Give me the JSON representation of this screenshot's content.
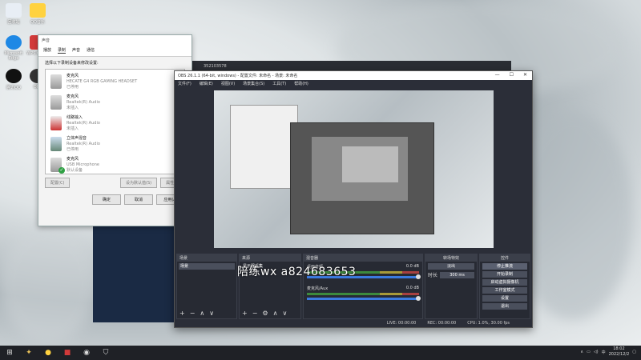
{
  "desktop": {
    "icons": [
      {
        "label": "回收站"
      },
      {
        "label": "QQ音乐"
      },
      {
        "label": "Microsoft Edge"
      },
      {
        "label": "WPS Office"
      },
      {
        "label": "腾讯QQ"
      },
      {
        "label": "OBS"
      }
    ]
  },
  "sound_dialog": {
    "title": "声音",
    "tabs": [
      "播放",
      "录制",
      "声音",
      "通信"
    ],
    "instruction": "选择以下录制设备来修改设置:",
    "devices": [
      {
        "name": "麦克风",
        "driver": "HECATE G4 RGB GAMING HEADSET",
        "status": "已停用"
      },
      {
        "name": "麦克风",
        "driver": "Realtek(R) Audio",
        "status": "未插入"
      },
      {
        "name": "线路输入",
        "driver": "Realtek(R) Audio",
        "status": "未插入"
      },
      {
        "name": "立体声混音",
        "driver": "Realtek(R) Audio",
        "status": "已停用"
      },
      {
        "name": "麦克风",
        "driver": "USB Microphone",
        "status": "默认设备"
      }
    ],
    "configure_label": "配置(C)",
    "set_default_label": "设为默认值(S)",
    "properties_label": "属性(P)",
    "ok_label": "确定",
    "cancel_label": "取消",
    "apply_label": "应用(A)"
  },
  "bg_bar": {
    "text": "352103578"
  },
  "obs": {
    "title": "OBS 26.1.1 (64-bit, windows) - 配置文件: 未命名 - 场景: 未命名",
    "menu": [
      "文件(F)",
      "编辑(E)",
      "视图(V)",
      "场景集合(S)",
      "工具(T)",
      "帮助(H)"
    ],
    "scenes_header": "场景",
    "scenes": [
      "场景"
    ],
    "sources_header": "来源",
    "sources": [
      "显示器采集"
    ],
    "mixer_header": "混音器",
    "mixer_tracks": [
      {
        "name": "桌面音频",
        "db": "0.0 dB"
      },
      {
        "name": "麦克风/Aux",
        "db": "0.0 dB"
      }
    ],
    "transitions_header": "转场特效",
    "transition_type": "淡出",
    "duration_label": "时长",
    "duration_value": "300 ms",
    "controls_header": "控件",
    "controls": [
      "停止推流",
      "开始录制",
      "启动虚拟摄像机",
      "工作室模式",
      "设置",
      "退出"
    ],
    "status": {
      "live": "LIVE: 00:00:00",
      "rec": "REC: 00:00:00",
      "cpu": "CPU: 1.0%, 30.00 fps"
    }
  },
  "watermark": "陪练wx a824683653",
  "taskbar": {
    "time": "18:02",
    "date": "2022/12/2"
  },
  "colors": {
    "taskbar": "#1f2126",
    "obs_bg": "#2b2e38",
    "accent": "#3b7be0",
    "default_ok": "#2ea043"
  }
}
